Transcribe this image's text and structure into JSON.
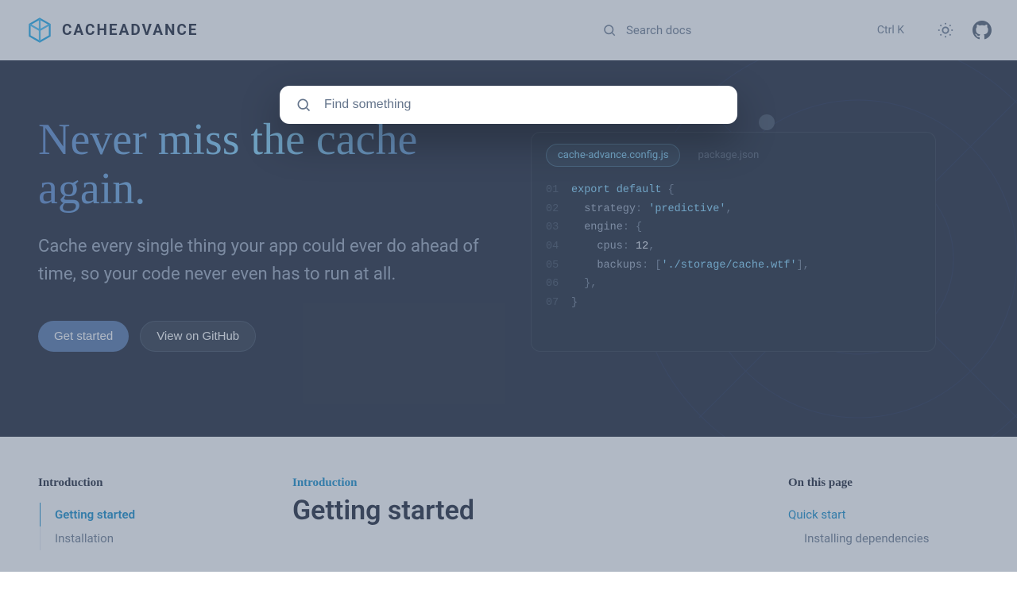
{
  "header": {
    "brand": "CACHEADVANCE",
    "search_placeholder": "Search docs",
    "search_kbd": "Ctrl K"
  },
  "modal": {
    "placeholder": "Find something"
  },
  "hero": {
    "title": "Never miss the cache again.",
    "subtitle": "Cache every single thing your app could ever do ahead of time, so your code never even has to run at all.",
    "btn_primary": "Get started",
    "btn_secondary": "View on GitHub"
  },
  "code": {
    "tabs": [
      "cache-advance.config.js",
      "package.json"
    ],
    "lines": [
      {
        "n": "01",
        "html": "<span class='tok-kw'>export default</span> <span class='tok-punc'>{</span>"
      },
      {
        "n": "02",
        "html": "  <span class='tok-prop'>strategy</span><span class='tok-punc'>:</span> <span class='tok-str'>'predictive'</span><span class='tok-punc'>,</span>"
      },
      {
        "n": "03",
        "html": "  <span class='tok-prop'>engine</span><span class='tok-punc'>: {</span>"
      },
      {
        "n": "04",
        "html": "    <span class='tok-prop'>cpus</span><span class='tok-punc'>:</span> <span class='tok-num'>12</span><span class='tok-punc'>,</span>"
      },
      {
        "n": "05",
        "html": "    <span class='tok-prop'>backups</span><span class='tok-punc'>: [</span><span class='tok-str'>'./storage/cache.wtf'</span><span class='tok-punc'>],</span>"
      },
      {
        "n": "06",
        "html": "  <span class='tok-punc'>},</span>"
      },
      {
        "n": "07",
        "html": "<span class='tok-punc'>}</span>"
      }
    ]
  },
  "sidebar": {
    "section": "Introduction",
    "items": [
      {
        "label": "Getting started",
        "active": true
      },
      {
        "label": "Installation",
        "active": false
      }
    ]
  },
  "main": {
    "eyebrow": "Introduction",
    "title": "Getting started"
  },
  "toc": {
    "heading": "On this page",
    "items": [
      {
        "label": "Quick start",
        "active": true,
        "sub": false
      },
      {
        "label": "Installing dependencies",
        "active": false,
        "sub": true
      }
    ]
  }
}
